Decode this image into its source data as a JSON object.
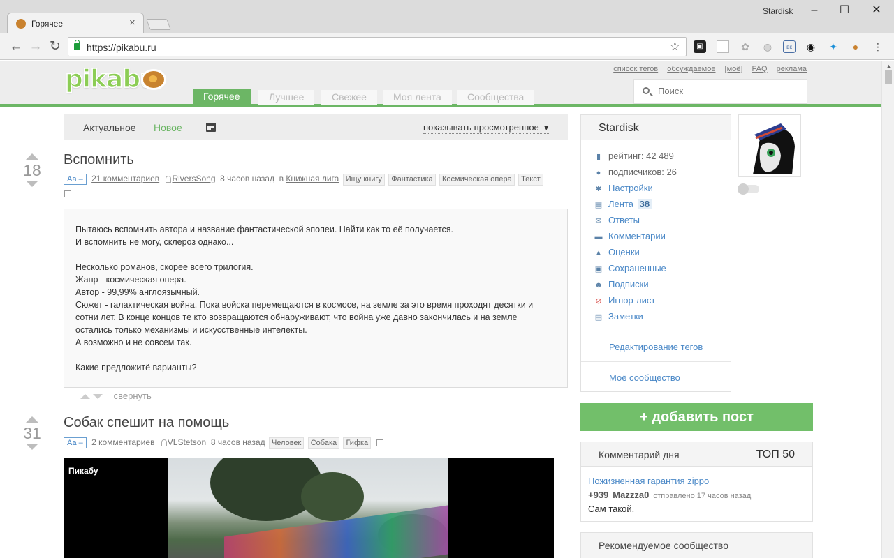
{
  "browser": {
    "tab_title": "Горячее",
    "user": "Stardisk",
    "url": "https://pikabu.ru"
  },
  "header": {
    "logo": "pikabu",
    "top_links": [
      "список тегов",
      "обсуждаемое",
      "[моё]",
      "FAQ",
      "реклама"
    ],
    "tabs": [
      "Горячее",
      "Лучшее",
      "Свежее",
      "Моя лента",
      "Сообщества"
    ],
    "search_placeholder": "Поиск"
  },
  "subbar": {
    "actual": "Актуальное",
    "new": "Новое",
    "dropdown": "показывать просмотренное"
  },
  "posts": [
    {
      "rating": "18",
      "title": "Вспомнить",
      "aa": "Аа –",
      "comments": "21 комментариев",
      "author": "RiversSong",
      "time": "8 часов назад",
      "in": "в",
      "community": "Книжная лига",
      "tags": [
        "Ищу книгу",
        "Фантастика",
        "Космическая опера",
        "Текст"
      ],
      "body": [
        "Пытаюсь вспомнить автора и название фантастической эпопеи. Найти как то её получается.",
        "И вспомнить не могу, склероз однако...",
        "",
        "Несколько романов, скорее всего трилогия.",
        "Жанр - космическая опера.",
        "Автор - 99,99% англоязычный.",
        "Сюжет - галактическая война. Пока войска перемещаются в космосе, на земле за это время проходят десятки и сотни лет. В конце концов те кто возвращаются обнаруживают, что война уже давно закончилась и на земле остались только механизмы и искусственные интелекты.",
        "А возможно и не совсем так.",
        "",
        "Какие предложитё варианты?"
      ],
      "collapse": "свернуть"
    },
    {
      "rating": "31",
      "title": "Собак спешит на помощь",
      "aa": "Аа –",
      "comments": "2 комментариев",
      "author": "VLStetson",
      "time": "8 часов назад",
      "tags": [
        "Человек",
        "Собака",
        "Гифка"
      ],
      "video_label": "Пикабу"
    }
  ],
  "sidebar": {
    "username": "Stardisk",
    "menu": [
      {
        "icon": "rating-icon",
        "label": "рейтинг: 42 489"
      },
      {
        "icon": "subscribers-icon",
        "label": "подписчиков: 26"
      },
      {
        "icon": "settings-icon",
        "label": "Настройки"
      },
      {
        "icon": "feed-icon",
        "label": "Лента",
        "badge": "38"
      },
      {
        "icon": "replies-icon",
        "label": "Ответы"
      },
      {
        "icon": "comments-icon",
        "label": "Комментарии"
      },
      {
        "icon": "ratings-icon",
        "label": "Оценки"
      },
      {
        "icon": "saved-icon",
        "label": "Сохраненные"
      },
      {
        "icon": "subscriptions-icon",
        "label": "Подписки"
      },
      {
        "icon": "ignore-icon",
        "label": "Игнор-лист"
      },
      {
        "icon": "notes-icon",
        "label": "Заметки"
      }
    ],
    "edit_tags": "Редактирование тегов",
    "my_community": "Моё сообщество",
    "add_post": "+  добавить пост",
    "comment_of_day": {
      "title": "Комментарий дня",
      "top": "ТОП 50",
      "link": "Пожизненная гарантия zippo",
      "score": "+939",
      "user": "Mazzza0",
      "sent": "отправлено 17 часов назад",
      "text": "Сам такой."
    },
    "recommended": "Рекомендуемое сообщество"
  }
}
